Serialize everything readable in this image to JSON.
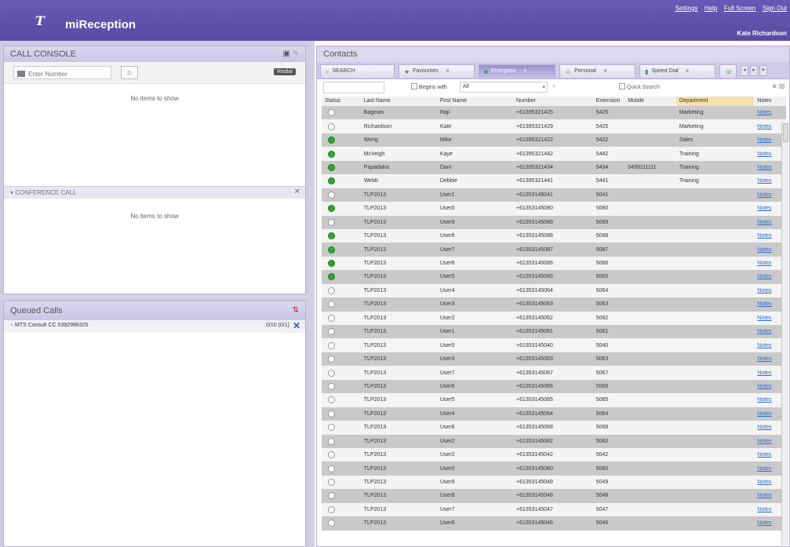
{
  "header": {
    "app_title": "miReception",
    "links": [
      "Settings",
      "Help",
      "Full Screen",
      "Sign Out"
    ],
    "user": "Kate Richardson"
  },
  "call_console": {
    "title": "CALL CONSOLE",
    "input_placeholder": "Enter Number",
    "redial_label": "Redial",
    "empty_text": "No items to show"
  },
  "conference": {
    "title": "CONFERENCE CALL",
    "empty_text": "No items to show"
  },
  "queued": {
    "title": "Queued Calls",
    "row_label": "MTS Consult CC 0392998325",
    "row_meta": "0/10 (0/1)"
  },
  "contacts": {
    "title": "Contacts",
    "tabs": [
      {
        "label": "SEARCH",
        "closable": false
      },
      {
        "label": "Favourites",
        "closable": true
      },
      {
        "label": "Enterprise",
        "closable": true,
        "active": true
      },
      {
        "label": "Personal",
        "closable": true
      },
      {
        "label": "Speed Dial",
        "closable": true
      }
    ],
    "filter": {
      "begins_with_label": "Begins with",
      "begins_with_value": "All",
      "quick_search_label": "Quick Search"
    },
    "columns": [
      "Status",
      "Last Name",
      "First Name",
      "Number",
      "Extension",
      "Mobile",
      "Department",
      "Notes"
    ],
    "rows": [
      {
        "status": "idle",
        "last": "Bagmas",
        "first": "Raji",
        "number": "+61395321425",
        "ext": "5425",
        "mobile": "",
        "dept": "Marketing",
        "notes": "Notes"
      },
      {
        "status": "idle",
        "last": "Richardson",
        "first": "Kate",
        "number": "+61395321429",
        "ext": "5425",
        "mobile": "",
        "dept": "Marketing",
        "notes": "Notes"
      },
      {
        "status": "busy",
        "last": "Wong",
        "first": "Mike",
        "number": "+61395321422",
        "ext": "5422",
        "mobile": "",
        "dept": "Sales",
        "notes": "Notes"
      },
      {
        "status": "busy",
        "last": "McVeigh",
        "first": "Kaye",
        "number": "+61395321442",
        "ext": "5442",
        "mobile": "",
        "dept": "Training",
        "notes": "Notes"
      },
      {
        "status": "busy",
        "last": "Papadakis",
        "first": "Dani",
        "number": "+61395321434",
        "ext": "5434",
        "mobile": "0499111111",
        "dept": "Training",
        "notes": "Notes"
      },
      {
        "status": "busy",
        "last": "Webb",
        "first": "Debbie",
        "number": "+61395321441",
        "ext": "5441",
        "mobile": "",
        "dept": "Training",
        "notes": "Notes"
      },
      {
        "status": "idle",
        "last": "TLP2013",
        "first": "User1",
        "number": "+61353145041",
        "ext": "5041",
        "mobile": "",
        "dept": "",
        "notes": "Notes"
      },
      {
        "status": "busy",
        "last": "TLP2013",
        "first": "User0",
        "number": "+61353145080",
        "ext": "5080",
        "mobile": "",
        "dept": "",
        "notes": "Notes"
      },
      {
        "status": "idle",
        "last": "TLP2013",
        "first": "User9",
        "number": "+61353145089",
        "ext": "5089",
        "mobile": "",
        "dept": "",
        "notes": "Notes"
      },
      {
        "status": "busy",
        "last": "TLP2013",
        "first": "User8",
        "number": "+61353145088",
        "ext": "5088",
        "mobile": "",
        "dept": "",
        "notes": "Notes"
      },
      {
        "status": "busy",
        "last": "TLP2013",
        "first": "User7",
        "number": "+61353145087",
        "ext": "5087",
        "mobile": "",
        "dept": "",
        "notes": "Notes"
      },
      {
        "status": "busy",
        "last": "TLP2013",
        "first": "User6",
        "number": "+61353145086",
        "ext": "5086",
        "mobile": "",
        "dept": "",
        "notes": "Notes"
      },
      {
        "status": "busy",
        "last": "TLP2013",
        "first": "User5",
        "number": "+61353145065",
        "ext": "5065",
        "mobile": "",
        "dept": "",
        "notes": "Notes"
      },
      {
        "status": "idle",
        "last": "TLP2013",
        "first": "User4",
        "number": "+61353145064",
        "ext": "5064",
        "mobile": "",
        "dept": "",
        "notes": "Notes"
      },
      {
        "status": "idle",
        "last": "TLP2013",
        "first": "User3",
        "number": "+61353145063",
        "ext": "5063",
        "mobile": "",
        "dept": "",
        "notes": "Notes"
      },
      {
        "status": "idle",
        "last": "TLP2013",
        "first": "User2",
        "number": "+61353145062",
        "ext": "5062",
        "mobile": "",
        "dept": "",
        "notes": "Notes"
      },
      {
        "status": "idle",
        "last": "TLP2013",
        "first": "User1",
        "number": "+61353145061",
        "ext": "5061",
        "mobile": "",
        "dept": "",
        "notes": "Notes"
      },
      {
        "status": "idle",
        "last": "TLP2013",
        "first": "User0",
        "number": "+61353145040",
        "ext": "5040",
        "mobile": "",
        "dept": "",
        "notes": "Notes"
      },
      {
        "status": "idle",
        "last": "TLP2013",
        "first": "User3",
        "number": "+61353145063",
        "ext": "5063",
        "mobile": "",
        "dept": "",
        "notes": "Notes"
      },
      {
        "status": "idle",
        "last": "TLP2013",
        "first": "User7",
        "number": "+61353145067",
        "ext": "5067",
        "mobile": "",
        "dept": "",
        "notes": "Notes"
      },
      {
        "status": "idle",
        "last": "TLP2013",
        "first": "User6",
        "number": "+61353145066",
        "ext": "5066",
        "mobile": "",
        "dept": "",
        "notes": "Notes"
      },
      {
        "status": "idle",
        "last": "TLP2013",
        "first": "User5",
        "number": "+61353145065",
        "ext": "5065",
        "mobile": "",
        "dept": "",
        "notes": "Notes"
      },
      {
        "status": "idle",
        "last": "TLP2013",
        "first": "User4",
        "number": "+61353145064",
        "ext": "5064",
        "mobile": "",
        "dept": "",
        "notes": "Notes"
      },
      {
        "status": "idle",
        "last": "TLP2013",
        "first": "User8",
        "number": "+61353145068",
        "ext": "5068",
        "mobile": "",
        "dept": "",
        "notes": "Notes"
      },
      {
        "status": "idle",
        "last": "TLP2013",
        "first": "User2",
        "number": "+61353145062",
        "ext": "5062",
        "mobile": "",
        "dept": "",
        "notes": "Notes"
      },
      {
        "status": "idle",
        "last": "TLP2013",
        "first": "User2",
        "number": "+61353145042",
        "ext": "5042",
        "mobile": "",
        "dept": "",
        "notes": "Notes"
      },
      {
        "status": "idle",
        "last": "TLP2013",
        "first": "User0",
        "number": "+61353145060",
        "ext": "5060",
        "mobile": "",
        "dept": "",
        "notes": "Notes"
      },
      {
        "status": "idle",
        "last": "TLP2013",
        "first": "User9",
        "number": "+61353145049",
        "ext": "5049",
        "mobile": "",
        "dept": "",
        "notes": "Notes"
      },
      {
        "status": "idle",
        "last": "TLP2013",
        "first": "User8",
        "number": "+61353145048",
        "ext": "5048",
        "mobile": "",
        "dept": "",
        "notes": "Notes"
      },
      {
        "status": "idle",
        "last": "TLP2013",
        "first": "User7",
        "number": "+61353145047",
        "ext": "5047",
        "mobile": "",
        "dept": "",
        "notes": "Notes"
      },
      {
        "status": "idle",
        "last": "TLP2013",
        "first": "User6",
        "number": "+61353145046",
        "ext": "5046",
        "mobile": "",
        "dept": "",
        "notes": "Notes"
      }
    ]
  }
}
